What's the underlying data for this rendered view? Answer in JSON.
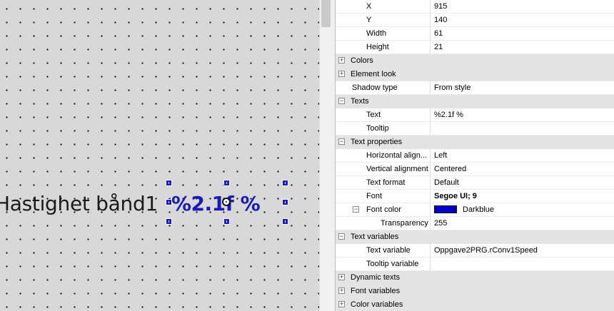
{
  "canvas": {
    "label_text": "Hastighet bånd1",
    "value_text": "%2.1f %"
  },
  "properties": {
    "position": [
      {
        "name": "X",
        "value": "915"
      },
      {
        "name": "Y",
        "value": "140"
      },
      {
        "name": "Width",
        "value": "61"
      },
      {
        "name": "Height",
        "value": "21"
      }
    ],
    "colors": {
      "label": "Colors",
      "expander": "+"
    },
    "element_look": {
      "label": "Element look",
      "expander": "+"
    },
    "shadow_type": {
      "name": "Shadow type",
      "value": "From style"
    },
    "texts": {
      "label": "Texts",
      "expander": "−",
      "rows": [
        {
          "name": "Text",
          "value": "%2.1f %"
        },
        {
          "name": "Tooltip",
          "value": ""
        }
      ]
    },
    "text_properties": {
      "label": "Text properties",
      "expander": "−",
      "rows": [
        {
          "name": "Horizontal align...",
          "value": "Left"
        },
        {
          "name": "Vertical alignment",
          "value": "Centered"
        },
        {
          "name": "Text format",
          "value": "Default"
        }
      ],
      "font": {
        "name": "Font",
        "value": "Segoe UI; 9"
      },
      "font_color": {
        "name": "Font color",
        "value": "Darkblue",
        "expander": "−",
        "swatch_color": "#0000c8"
      },
      "transparency": {
        "name": "Transparency",
        "value": "255"
      }
    },
    "text_variables": {
      "label": "Text variables",
      "expander": "−",
      "rows": [
        {
          "name": "Text variable",
          "value": "Oppgave2PRG.rConv1Speed"
        },
        {
          "name": "Tooltip variable",
          "value": ""
        }
      ]
    },
    "dynamic_texts": {
      "label": "Dynamic texts",
      "expander": "+"
    },
    "font_variables": {
      "label": "Font variables",
      "expander": "+"
    },
    "color_variables": {
      "label": "Color variables",
      "expander": "+"
    }
  }
}
